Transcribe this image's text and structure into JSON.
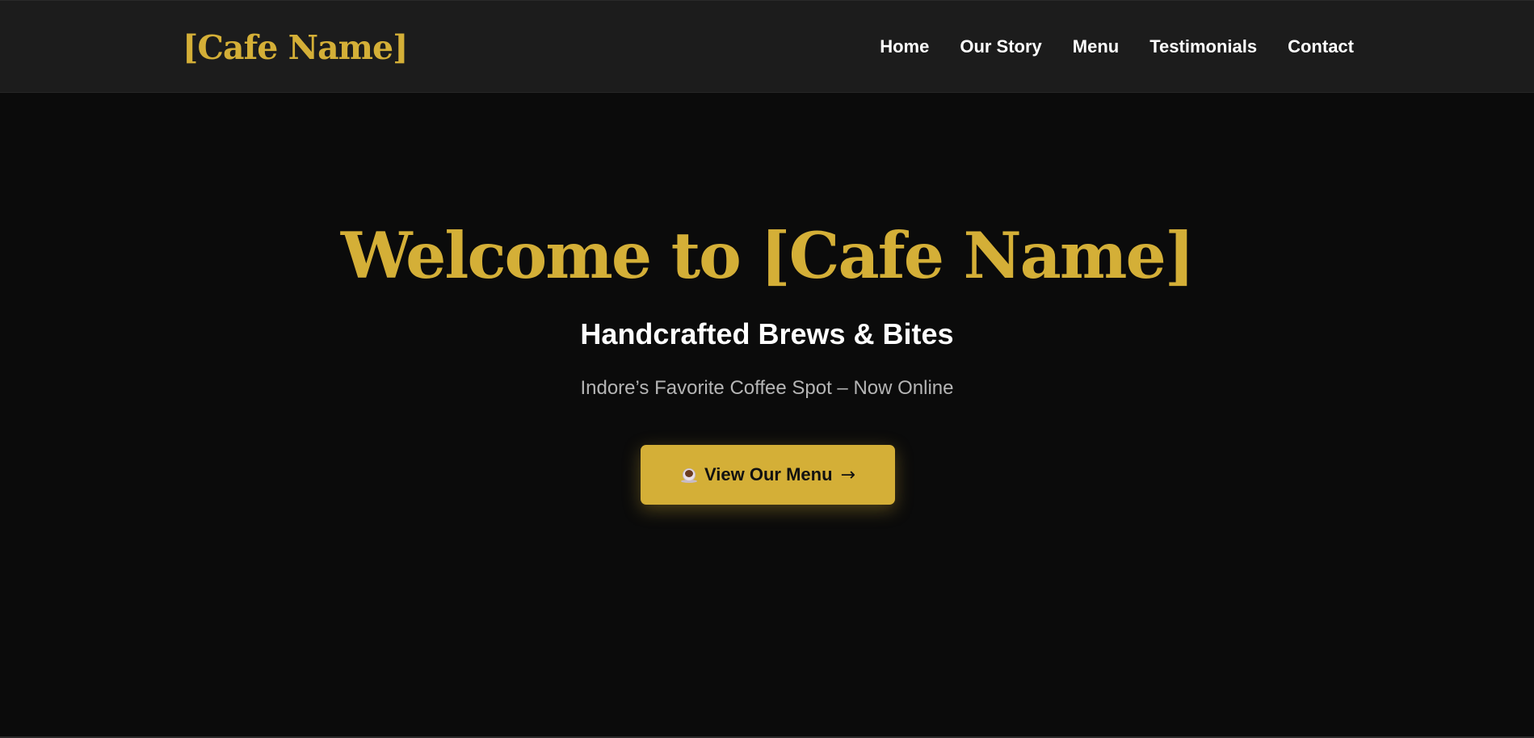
{
  "nav": {
    "brand": "[Cafe Name]",
    "links": [
      "Home",
      "Our Story",
      "Menu",
      "Testimonials",
      "Contact"
    ]
  },
  "hero": {
    "title": "Welcome to [Cafe Name]",
    "subtitle": "Handcrafted Brews & Bites",
    "tagline": "Indore’s Favorite Coffee Spot – Now Online",
    "cta": {
      "icon": "coffee-cup-icon",
      "label": "View Our Menu",
      "arrow": "→"
    }
  },
  "colors": {
    "accent": "#d4af37",
    "nav_background": "#1c1c1c",
    "page_background": "#0b0b0b",
    "tagline_text": "#b5b5b5"
  }
}
